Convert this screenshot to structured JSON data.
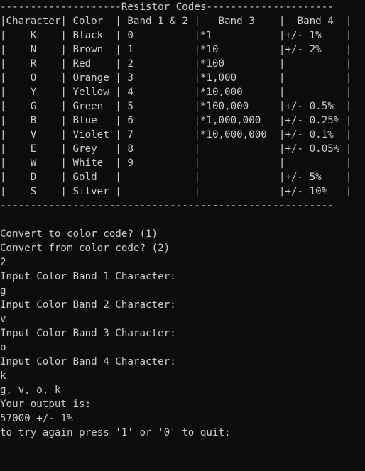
{
  "terminal": {
    "lines": [
      "--------------------Resistor Codes---------------------",
      "|Character| Color  | Band 1 & 2 |   Band 3    |  Band 4  |",
      "|    K    | Black  | 0          |*1           |+/- 1%    |",
      "|    N    | Brown  | 1          |*10          |+/- 2%    |",
      "|    R    | Red    | 2          |*100         |          |",
      "|    O    | Orange | 3          |*1,000       |          |",
      "|    Y    | Yellow | 4          |*10,000      |          |",
      "|    G    | Green  | 5          |*100,000     |+/- 0.5%  |",
      "|    B    | Blue   | 6          |*1,000,000   |+/- 0.25% |",
      "|    V    | Violet | 7          |*10,000,000  |+/- 0.1%  |",
      "|    E    | Grey   | 8          |             |+/- 0.05% |",
      "|    W    | White  | 9          |             |          |",
      "|    D    | Gold   |            |             |+/- 5%    |",
      "|    S    | Silver |            |             |+/- 10%   |",
      "-------------------------------------------------------",
      "",
      "Convert to color code? (1)",
      "Convert from color code? (2)",
      "2",
      "Input Color Band 1 Character:",
      "g",
      "Input Color Band 2 Character:",
      "v",
      "Input Color Band 3 Character:",
      "o",
      "Input Color Band 4 Character:",
      "k",
      "g, v, o, k",
      "Your output is:",
      "57000 +/- 1%",
      "to try again press '1' or '0' to quit:"
    ]
  }
}
